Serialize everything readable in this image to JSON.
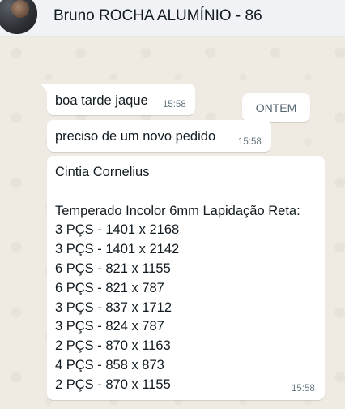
{
  "header": {
    "contact_name": "Bruno ROCHA ALUMÍNIO - 86",
    "avatar_icon": "contact-avatar-photo"
  },
  "chat": {
    "date_separator": "ONTEM",
    "messages": [
      {
        "text": "boa tarde jaque",
        "time": "15:58"
      },
      {
        "text": "preciso de um novo pedido",
        "time": "15:58"
      },
      {
        "text": "Cintia Cornelius\n\nTemperado Incolor 6mm Lapidação Reta:\n3 PÇS - 1401 x 2168\n3 PÇS - 1401 x 2142\n6 PÇS - 821 x 1155\n6 PÇS - 821 x 787\n3 PÇS - 837 x 1712\n3 PÇS - 824 x 787\n2 PÇS - 870 x 1163\n4 PÇS - 858 x 873\n2 PÇS - 870 x 1155",
        "time": "15:58"
      }
    ]
  },
  "colors": {
    "header_bg": "#f0f2f5",
    "chat_bg": "#efeae2",
    "bubble_bg": "#ffffff",
    "text": "#111b21",
    "meta_text": "#667781"
  }
}
